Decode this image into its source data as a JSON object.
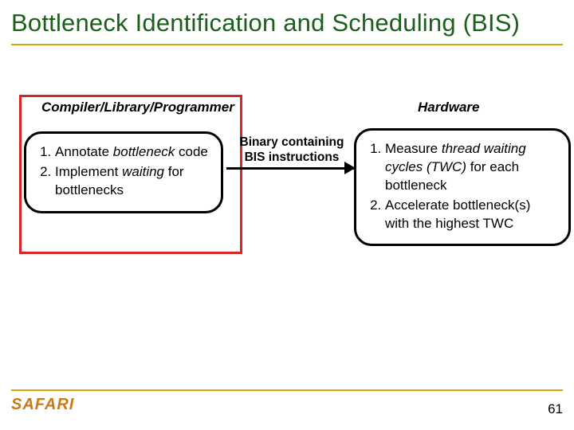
{
  "title": "Bottleneck Identification and Scheduling (BIS)",
  "labels": {
    "left": "Compiler/Library/Programmer",
    "right": "Hardware"
  },
  "left_box": {
    "item1_pre": "Annotate ",
    "item1_em": "bottleneck",
    "item1_post": " code",
    "item2_pre": "Implement ",
    "item2_em": "waiting",
    "item2_post": " for bottlenecks"
  },
  "right_box": {
    "item1_pre": "Measure ",
    "item1_em1": "thread waiting cycles (TWC)",
    "item1_post": " for each bottleneck",
    "item2": "Accelerate bottleneck(s) with the highest TWC"
  },
  "arrow": {
    "line1": "Binary containing",
    "line2": "BIS instructions"
  },
  "brand": "SAFARI",
  "page_number": "61"
}
